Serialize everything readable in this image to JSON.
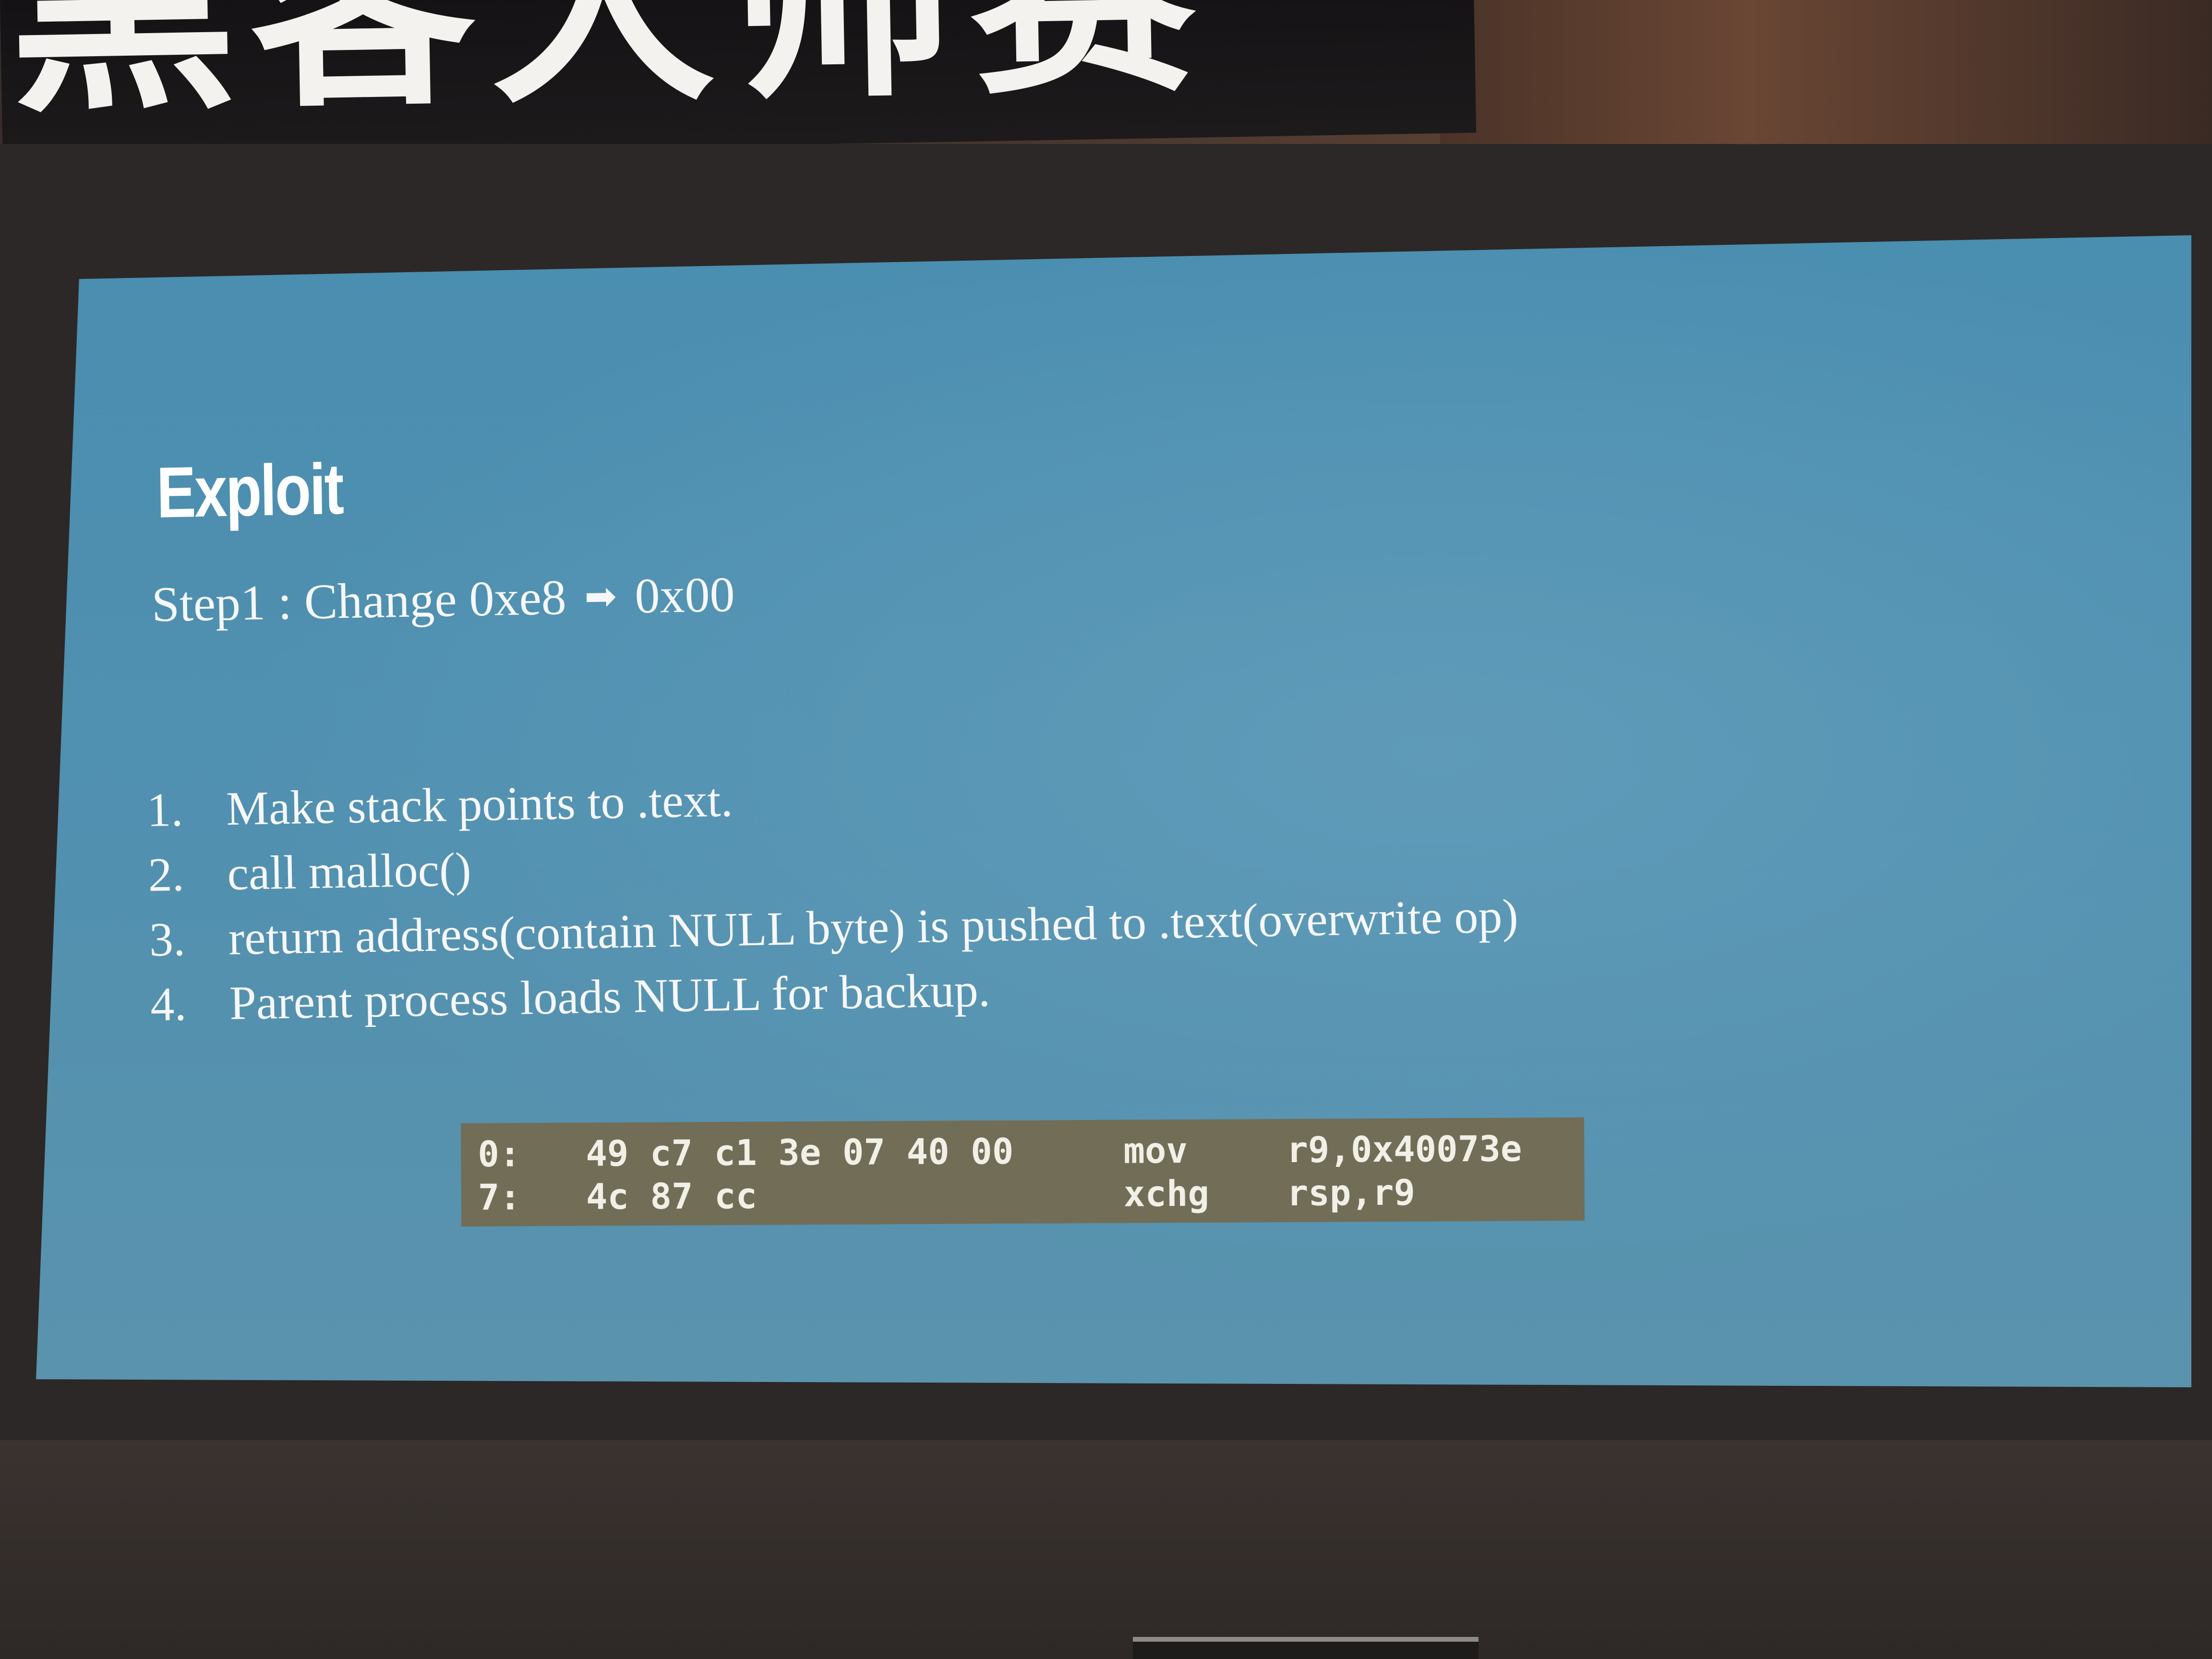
{
  "banner": {
    "text": "黑客大师赛"
  },
  "slide": {
    "title": "Exploit",
    "step": {
      "prefix": "Step1 : Change 0xe8",
      "arrow": "➡",
      "suffix": "0x00"
    },
    "list": [
      {
        "num": "1.",
        "text": "Make stack points to .text."
      },
      {
        "num": "2.",
        "text": "call malloc()"
      },
      {
        "num": "3.",
        "text": "return address(contain NULL byte) is pushed to .text(overwrite op)"
      },
      {
        "num": "4.",
        "text": "Parent process loads NULL for backup."
      }
    ],
    "code": [
      {
        "addr": "0:",
        "bytes": "49 c7 c1 3e 07 40 00",
        "op": "mov",
        "args": "r9,0x40073e"
      },
      {
        "addr": "7:",
        "bytes": "4c 87 cc",
        "op": "xchg",
        "args": "rsp,r9"
      }
    ]
  }
}
